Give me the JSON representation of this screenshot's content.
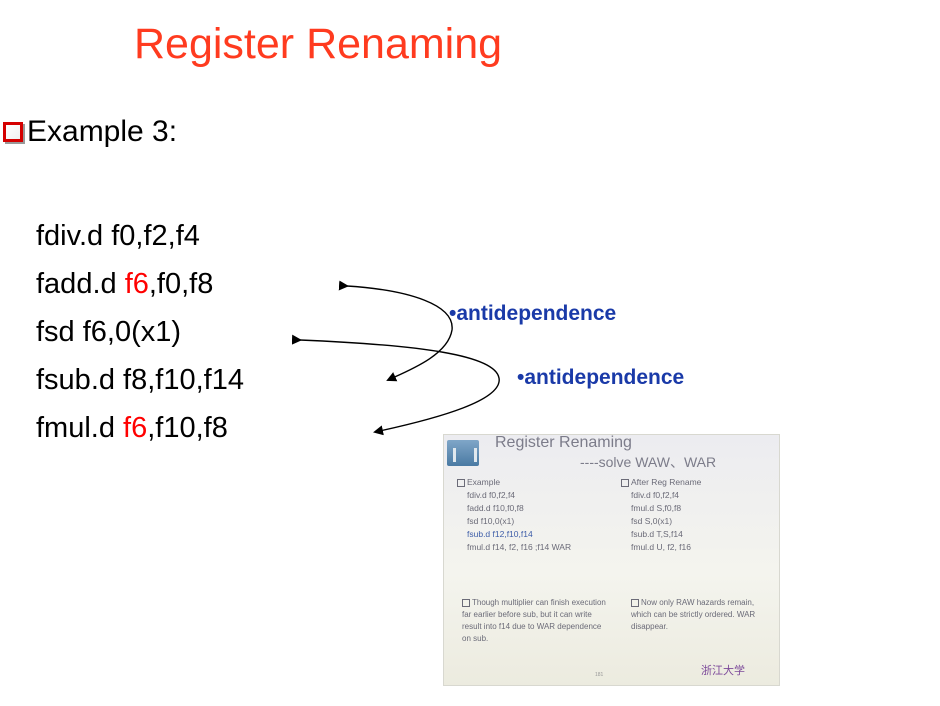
{
  "slide": {
    "title": "Register Renaming",
    "bullet": "Example 3:"
  },
  "code": [
    {
      "prefix": "fdiv.d f0,f2,f4",
      "highlight": "",
      "suffix": ""
    },
    {
      "prefix": "fadd.d ",
      "highlight": "f6",
      "suffix": ",f0,f8"
    },
    {
      "prefix": "fsd f6,0(x1)",
      "highlight": "",
      "suffix": ""
    },
    {
      "prefix": "fsub.d f8,f10,f14",
      "highlight": "",
      "suffix": ""
    },
    {
      "prefix": "fmul.d ",
      "highlight": "f6",
      "suffix": ",f10,f8"
    }
  ],
  "annotations": {
    "first": "•antidependence",
    "second": "•antidependence"
  },
  "photo": {
    "title": "Register Renaming",
    "subtitle": "----solve  WAW、WAR",
    "left_header": "Example",
    "left_lines": [
      "fdiv.d f0,f2,f4",
      "fadd.d f10,f0,f8",
      "fsd f10,0(x1)",
      "fsub.d f12,f10,f14",
      "fmul.d f14, f2, f16  ;f14  WAR"
    ],
    "right_header": "After Reg Rename",
    "right_lines": [
      "fdiv.d f0,f2,f4",
      "fmul.d S,f0,f8",
      "fsd S,0(x1)",
      "fsub.d T,S,f14",
      "fmul.d U, f2, f16"
    ],
    "left_note": "Though multiplier can finish execution far earlier before sub, but it can write result into f14 due to WAR dependence on sub.",
    "right_note": "Now only RAW hazards remain, which can be strictly ordered. WAR  disappear.",
    "footer_logo": "浙江大学",
    "page_number": "181"
  },
  "colors": {
    "title": "#ff3b1f",
    "register_highlight": "#ff0000",
    "annotation": "#1a3aa8",
    "bullet_box": "#d40000"
  }
}
